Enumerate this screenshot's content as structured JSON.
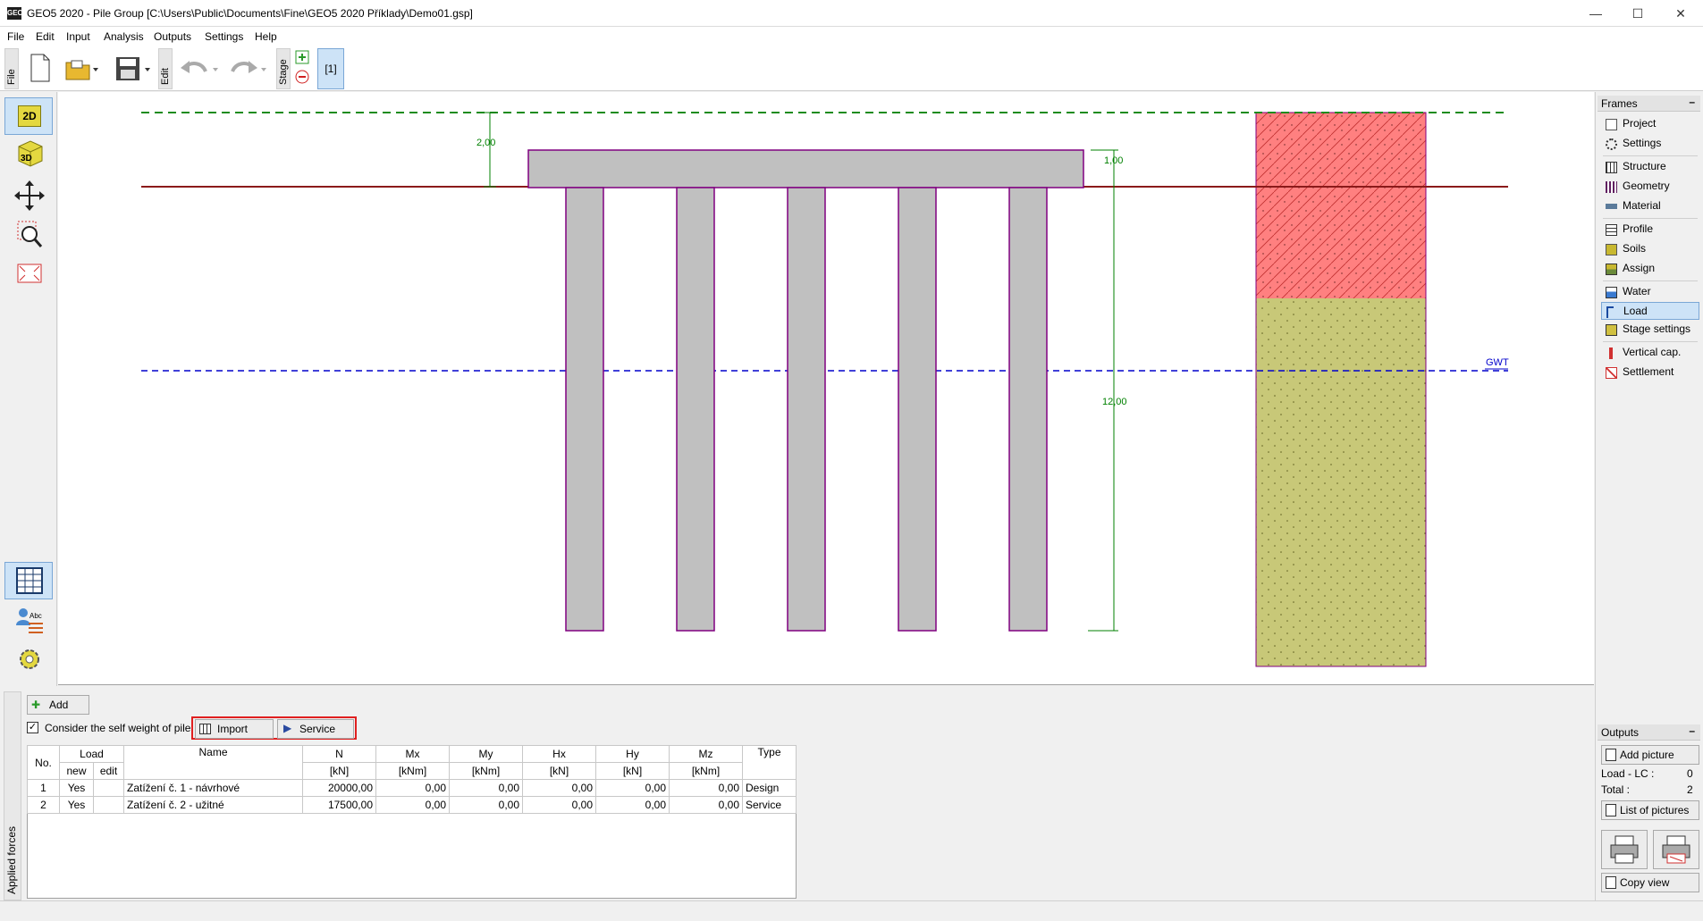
{
  "window": {
    "app_icon": "GEO",
    "title": "GEO5 2020 - Pile Group [C:\\Users\\Public\\Documents\\Fine\\GEO5 2020 Příklady\\Demo01.gsp]",
    "minimize": "—",
    "maximize": "☐",
    "close": "✕"
  },
  "menu": [
    "File",
    "Edit",
    "Input",
    "Analysis",
    "Outputs",
    "Settings",
    "Help"
  ],
  "toolbar": {
    "file_label": "File",
    "edit_label": "Edit",
    "stage_label": "Stage",
    "stage_value": "[1]"
  },
  "left_tools": {
    "view2d": "2D",
    "view3d": "3D"
  },
  "drawing": {
    "dim_depth": "2,00",
    "dim_cap": "1,00",
    "dim_pile": "12,00",
    "gwt_label": "GWT",
    "colors": {
      "ground_line": "#8b1a1a",
      "terrain_dashed": "#1e8c1e",
      "gwt_line": "#0000cc",
      "pile_fill": "#c0c0c0",
      "pile_stroke": "#800080",
      "soil1": "#ff8080",
      "soil2": "#c8c878",
      "dimension": "#008000"
    }
  },
  "frames": {
    "header": "Frames",
    "items": [
      {
        "label": "Project",
        "icon": "project-icon"
      },
      {
        "label": "Settings",
        "icon": "settings-icon"
      },
      {
        "label": "Structure",
        "icon": "structure-icon"
      },
      {
        "label": "Geometry",
        "icon": "geometry-icon"
      },
      {
        "label": "Material",
        "icon": "material-icon"
      },
      {
        "label": "Profile",
        "icon": "profile-icon"
      },
      {
        "label": "Soils",
        "icon": "soils-icon"
      },
      {
        "label": "Assign",
        "icon": "assign-icon"
      },
      {
        "label": "Water",
        "icon": "water-icon"
      },
      {
        "label": "Load",
        "icon": "load-icon"
      },
      {
        "label": "Stage settings",
        "icon": "stage-settings-icon"
      },
      {
        "label": "Vertical cap.",
        "icon": "vertical-cap-icon"
      },
      {
        "label": "Settlement",
        "icon": "settlement-icon"
      }
    ],
    "active": "Load"
  },
  "outputs": {
    "header": "Outputs",
    "add_picture": "Add picture",
    "load_lc_label": "Load - LC :",
    "load_lc_value": "0",
    "total_label": "Total :",
    "total_value": "2",
    "list_of_pictures": "List of pictures",
    "copy_view": "Copy view"
  },
  "bottom": {
    "side_tab": "Applied forces",
    "add": "Add",
    "checkbox_label": "Consider the self weight of pile",
    "checkbox_checked": true,
    "import": "Import",
    "service": "Service",
    "columns": {
      "no": "No.",
      "load": "Load",
      "new": "new",
      "edit": "edit",
      "name": "Name",
      "n": "N",
      "mx": "Mx",
      "my": "My",
      "hx": "Hx",
      "hy": "Hy",
      "mz": "Mz",
      "type": "Type",
      "kn": "[kN]",
      "knm": "[kNm]"
    },
    "rows": [
      {
        "no": "1",
        "new": "Yes",
        "edit": "",
        "name": "Zatížení č. 1 - návrhové",
        "n": "20000,00",
        "mx": "0,00",
        "my": "0,00",
        "hx": "0,00",
        "hy": "0,00",
        "mz": "0,00",
        "type": "Design"
      },
      {
        "no": "2",
        "new": "Yes",
        "edit": "",
        "name": "Zatížení č. 2 - užitné",
        "n": "17500,00",
        "mx": "0,00",
        "my": "0,00",
        "hx": "0,00",
        "hy": "0,00",
        "mz": "0,00",
        "type": "Service"
      }
    ]
  }
}
